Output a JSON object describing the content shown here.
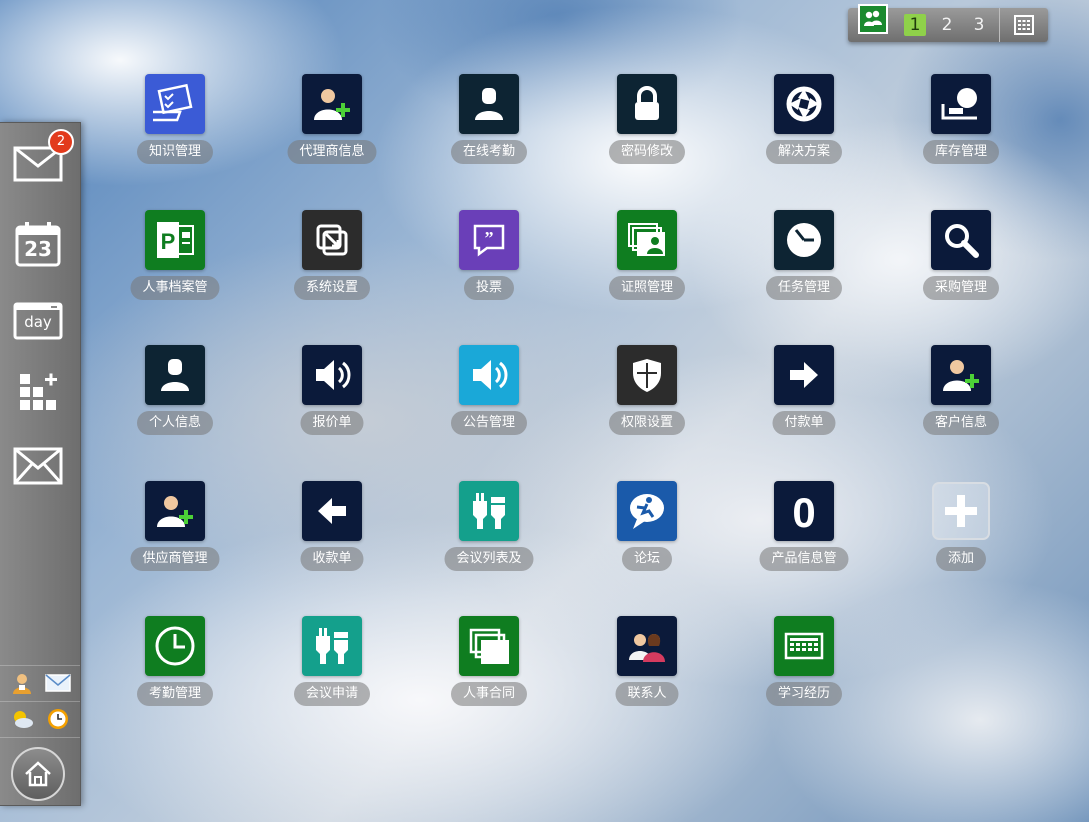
{
  "topbar": {
    "pages": [
      "1",
      "2",
      "3"
    ],
    "active_page": "1",
    "icons": [
      "people-group-icon",
      "grid-icon"
    ]
  },
  "dock": {
    "mail_badge": "2",
    "calendar_day": "23",
    "day_label": "day",
    "items": [
      "mail-icon",
      "calendar-icon",
      "day-view-icon",
      "add-widget-icon",
      "envelope-icon"
    ],
    "mini_items": [
      "user-service-icon",
      "mini-mail-icon",
      "weather-icon",
      "clock-icon"
    ],
    "home": "home-icon"
  },
  "apps": [
    {
      "label": "知识管理",
      "icon": "knowledge-icon",
      "color": "#3b5bd6"
    },
    {
      "label": "代理商信息",
      "icon": "agent-add-icon",
      "color": "#0b1a3a"
    },
    {
      "label": "在线考勤",
      "icon": "person-icon",
      "color": "#0d2433"
    },
    {
      "label": "密码修改",
      "icon": "lock-icon",
      "color": "#0d2433"
    },
    {
      "label": "解决方案",
      "icon": "aperture-icon",
      "color": "#0b1a3a"
    },
    {
      "label": "库存管理",
      "icon": "inventory-icon",
      "color": "#0b1a3a"
    },
    {
      "label": "人事档案管",
      "icon": "publisher-icon",
      "color": "#0f7d20"
    },
    {
      "label": "系统设置",
      "icon": "arrows-icon",
      "color": "#2c2c2c"
    },
    {
      "label": "投票",
      "icon": "quote-bubble-icon",
      "color": "#6a3fb8"
    },
    {
      "label": "证照管理",
      "icon": "certificate-icon",
      "color": "#0f7d20"
    },
    {
      "label": "任务管理",
      "icon": "clock-task-icon",
      "color": "#0d2433"
    },
    {
      "label": "采购管理",
      "icon": "search-icon",
      "color": "#0b1a3a"
    },
    {
      "label": "个人信息",
      "icon": "person-icon",
      "color": "#0d2433"
    },
    {
      "label": "报价单",
      "icon": "speaker-icon",
      "color": "#0b1a3a"
    },
    {
      "label": "公告管理",
      "icon": "speaker-icon",
      "color": "#1aa8d8"
    },
    {
      "label": "权限设置",
      "icon": "shield-icon",
      "color": "#2c2c2c"
    },
    {
      "label": "付款单",
      "icon": "arrow-right-icon",
      "color": "#0b1a3a"
    },
    {
      "label": "客户信息",
      "icon": "user-add-icon",
      "color": "#0b1a3a"
    },
    {
      "label": "供应商管理",
      "icon": "user-add-icon",
      "color": "#0b1a3a"
    },
    {
      "label": "收款单",
      "icon": "arrow-left-icon",
      "color": "#0b1a3a"
    },
    {
      "label": "会议列表及",
      "icon": "plug-icon",
      "color": "#14a08c"
    },
    {
      "label": "论坛",
      "icon": "forum-icon",
      "color": "#1a5aaa"
    },
    {
      "label": "产品信息管",
      "icon": "zero-icon",
      "color": "#0b1a3a"
    },
    {
      "label": "添加",
      "icon": "add-icon",
      "color": "transparent"
    },
    {
      "label": "考勤管理",
      "icon": "clock-icon",
      "color": "#0f7d20"
    },
    {
      "label": "会议申请",
      "icon": "plug-icon",
      "color": "#14a08c"
    },
    {
      "label": "人事合同",
      "icon": "windows-stack-icon",
      "color": "#0f7d20"
    },
    {
      "label": "联系人",
      "icon": "contacts-icon",
      "color": "#0b1a3a"
    },
    {
      "label": "学习经历",
      "icon": "keyboard-icon",
      "color": "#0f7d20"
    }
  ]
}
